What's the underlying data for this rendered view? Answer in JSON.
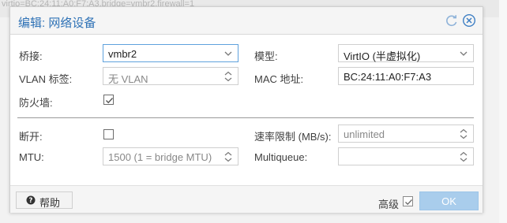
{
  "background": {
    "text": "virtio=BC:24:11:A0:F7:A3,bridge=vmbr2,firewall=1"
  },
  "dialog": {
    "title": "编辑: 网络设备",
    "accent_color": "#2f72b6",
    "header_icons": [
      "refresh-icon",
      "close-icon"
    ]
  },
  "form": {
    "bridge": {
      "label": "桥接:",
      "value": "vmbr2"
    },
    "vlan": {
      "label": "VLAN 标签:",
      "placeholder": "无 VLAN"
    },
    "firewall": {
      "label": "防火墙:",
      "checked": true
    },
    "model": {
      "label": "模型:",
      "value": "VirtIO (半虚拟化)"
    },
    "mac": {
      "label": "MAC 地址:",
      "value": "BC:24:11:A0:F7:A3"
    },
    "disconnect": {
      "label": "断开:",
      "checked": false
    },
    "mtu": {
      "label": "MTU:",
      "placeholder": "1500 (1 = bridge MTU)"
    },
    "rate_limit": {
      "label": "速率限制 (MB/s):",
      "placeholder": "unlimited"
    },
    "multiqueue": {
      "label": "Multiqueue:",
      "value": ""
    }
  },
  "footer": {
    "help_label": "帮助",
    "advanced_label": "高级",
    "advanced_checked": true,
    "ok_label": "OK",
    "ok_color": "#a9cdec"
  }
}
